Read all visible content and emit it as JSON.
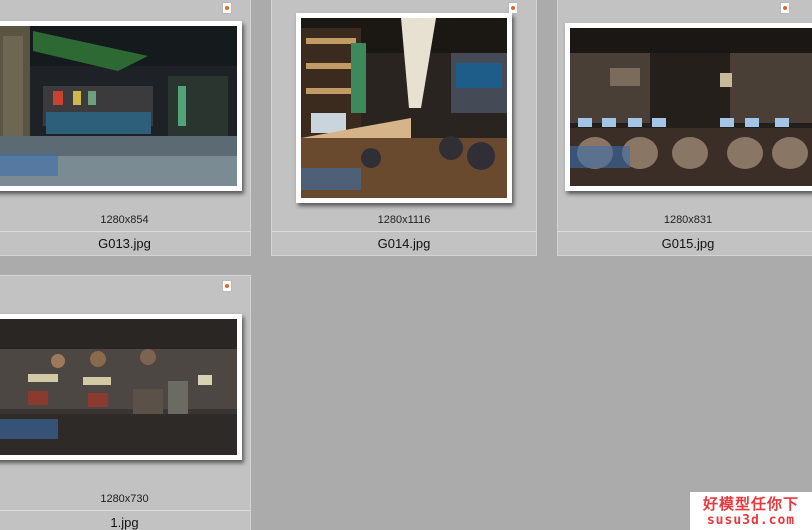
{
  "files": [
    {
      "dimensions": "1280x854",
      "name": "G013.jpg",
      "thumb_icon": "image-thumbnail-icon"
    },
    {
      "dimensions": "1280x1116",
      "name": "G014.jpg",
      "thumb_icon": "image-thumbnail-icon"
    },
    {
      "dimensions": "1280x831",
      "name": "G015.jpg",
      "thumb_icon": "image-thumbnail-icon"
    },
    {
      "dimensions": "1280x730",
      "name": "1.jpg",
      "thumb_icon": "image-thumbnail-icon"
    }
  ],
  "watermark": {
    "line1": "好模型任你下",
    "line2": "susu3d.com"
  },
  "colors": {
    "background": "#ababab",
    "tile": "#c2c2c2",
    "selection_border": "#d4d4d4",
    "watermark_red": "#e8383d"
  }
}
